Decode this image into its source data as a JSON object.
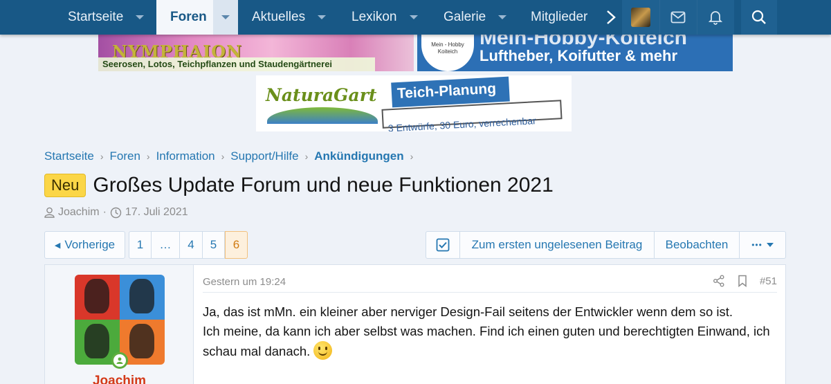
{
  "nav": {
    "items": [
      {
        "label": "Startseite"
      },
      {
        "label": "Foren"
      },
      {
        "label": "Aktuelles"
      },
      {
        "label": "Lexikon"
      },
      {
        "label": "Galerie"
      },
      {
        "label": "Mitglieder"
      }
    ],
    "icons": [
      "chevron-right-icon",
      "avatar",
      "mail-icon",
      "bell-icon",
      "search-icon"
    ]
  },
  "banners": {
    "b1": {
      "logo": "NYMPHAION",
      "tagline": "Seerosen, Lotos, Teichpflanzen und Staudengärtnerei"
    },
    "b2": {
      "disk": "Mein - Hobby Koiteich",
      "headline": "Mein-Hobby-Koiteich",
      "sub": "Luftheber, Koifutter & mehr"
    },
    "b3": {
      "brand": "NaturaGart",
      "headline": "Teich-Planung",
      "sub": "3 Entwürfe, 30 Euro, verrechenbar"
    }
  },
  "breadcrumb": [
    "Startseite",
    "Foren",
    "Information",
    "Support/Hilfe",
    "Ankündigungen"
  ],
  "thread": {
    "badge": "Neu",
    "title": "Großes Update Forum und neue Funktionen 2021",
    "author": "Joachim",
    "sep": "·",
    "date": "17. Juli 2021"
  },
  "pagination": {
    "prev": "Vorherige",
    "pages": [
      "1",
      "…",
      "4",
      "5",
      "6"
    ],
    "current": "6"
  },
  "actions": {
    "first_unread": "Zum ersten ungelesenen Beitrag",
    "watch": "Beobachten",
    "more": "•••"
  },
  "post": {
    "username": "Joachim",
    "time": "Gestern um 19:24",
    "number": "#51",
    "line1": "Ja, das ist mMn. ein kleiner aber nerviger Design-Fail seitens der Entwickler wenn dem so ist.",
    "line2": "Ich meine, da kann ich aber selbst was machen. Find ich einen guten und berechtigten Einwand, ich schau mal danach.",
    "avatar_colors": [
      "#d9372a",
      "#3b8fd9",
      "#4caa3c",
      "#ef7a2d"
    ]
  },
  "colors": {
    "nav_bg": "#185886",
    "accent": "#2577b1",
    "badge": "#fbd647",
    "username": "#d43a19"
  }
}
